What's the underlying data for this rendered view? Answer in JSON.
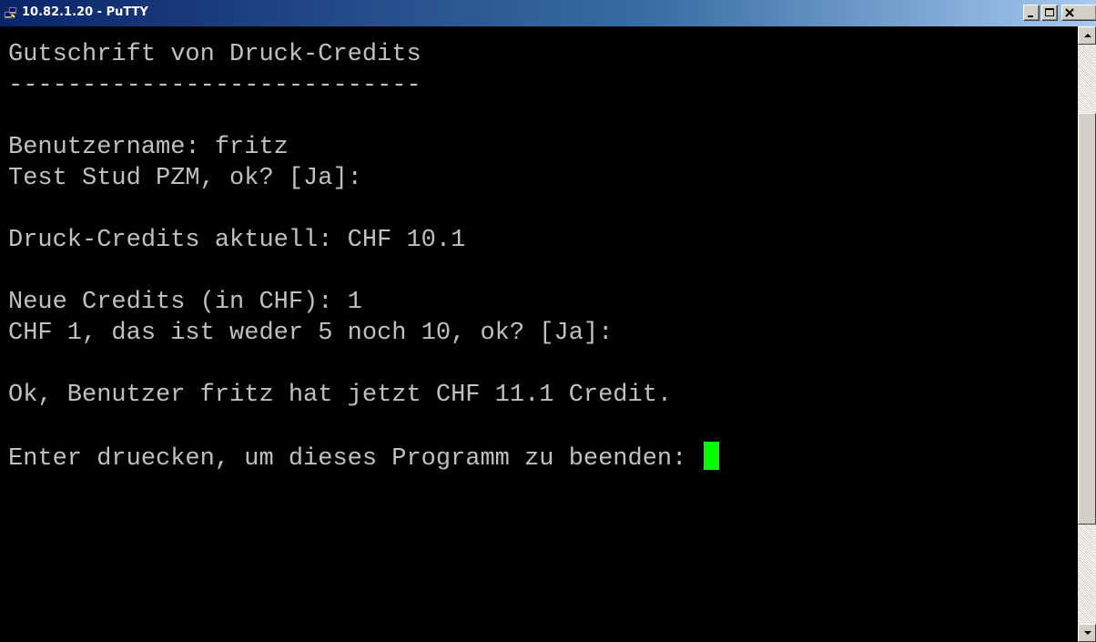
{
  "window": {
    "title": "10.82.1.20 - PuTTY",
    "icon": "putty-icon"
  },
  "controls": {
    "minimize_icon": "minimize-icon",
    "maximize_icon": "maximize-icon",
    "close_icon": "close-icon"
  },
  "terminal": {
    "foreground": "#c0c0c0",
    "background": "#000000",
    "cursor_color": "#00ff00",
    "lines": [
      "Gutschrift von Druck-Credits",
      "----------------------------",
      "",
      "Benutzername: fritz",
      "Test Stud PZM, ok? [Ja]:",
      "",
      "Druck-Credits aktuell: CHF 10.1",
      "",
      "Neue Credits (in CHF): 1",
      "CHF 1, das ist weder 5 noch 10, ok? [Ja]:",
      "",
      "Ok, Benutzer fritz hat jetzt CHF 11.1 Credit.",
      "",
      "Enter druecken, um dieses Programm zu beenden: "
    ]
  }
}
